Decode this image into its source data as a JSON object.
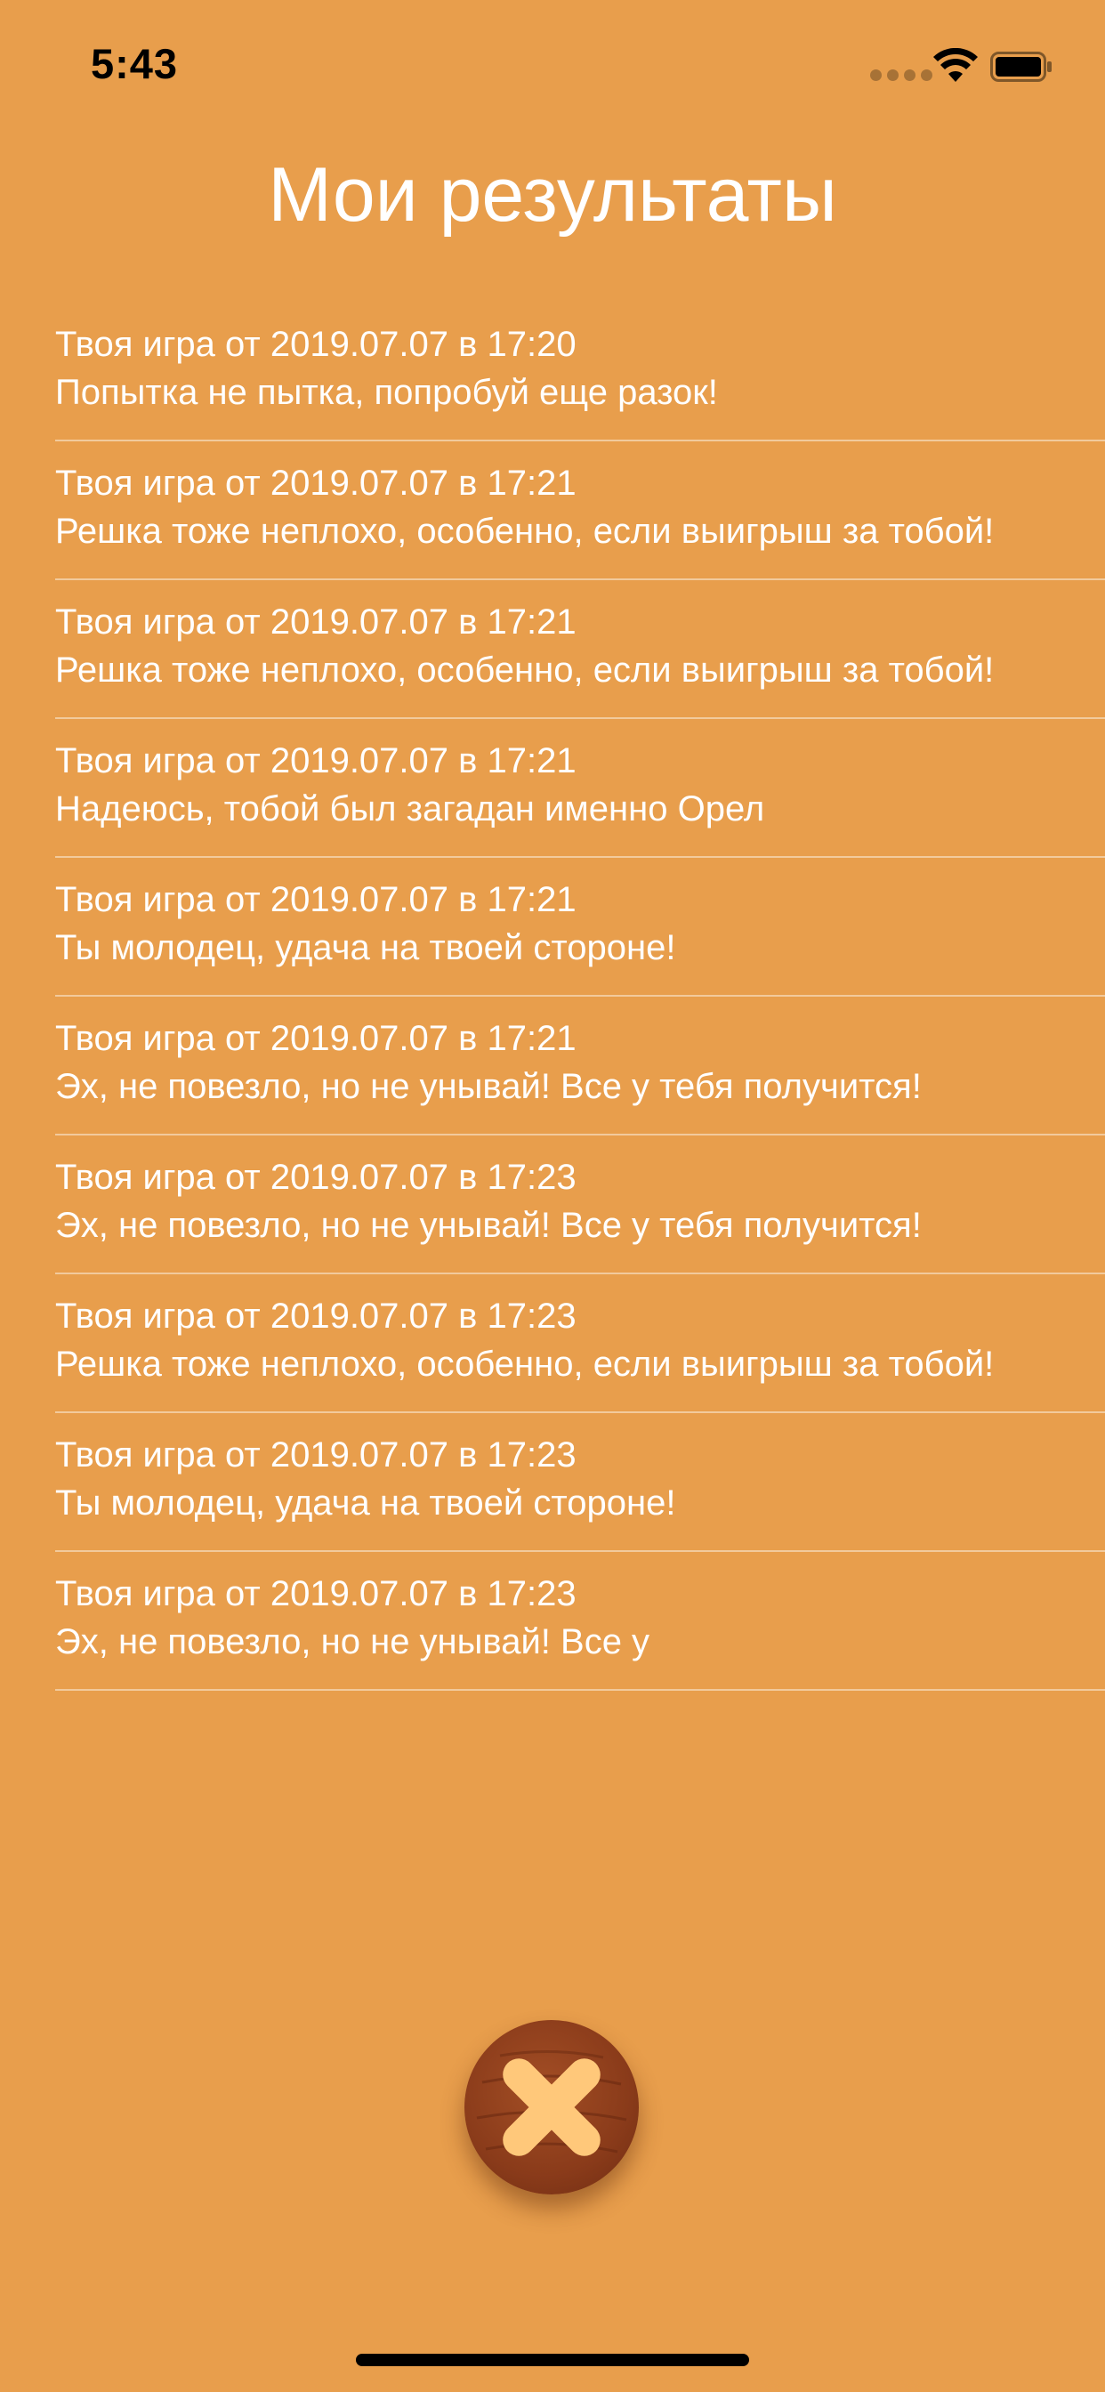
{
  "status_bar": {
    "time": "5:43",
    "signal_icon": "signal-dots-icon",
    "wifi_icon": "wifi-icon",
    "battery_icon": "battery-icon"
  },
  "header": {
    "title": "Мои результаты"
  },
  "results": [
    {
      "date": "Твоя игра от 2019.07.07 в 17:20",
      "message": "Попытка не пытка, попробуй еще разок!"
    },
    {
      "date": "Твоя игра от 2019.07.07 в 17:21",
      "message": "Решка тоже неплохо, особенно, если выигрыш за тобой!"
    },
    {
      "date": "Твоя игра от 2019.07.07 в 17:21",
      "message": "Решка тоже неплохо, особенно, если выигрыш за тобой!"
    },
    {
      "date": "Твоя игра от 2019.07.07 в 17:21",
      "message": "Надеюсь, тобой был загадан именно Орел"
    },
    {
      "date": "Твоя игра от 2019.07.07 в 17:21",
      "message": "Ты молодец, удача на твоей стороне!"
    },
    {
      "date": "Твоя игра от 2019.07.07 в 17:21",
      "message": "Эх, не повезло, но не унывай! Все у тебя получится!"
    },
    {
      "date": "Твоя игра от 2019.07.07 в 17:23",
      "message": "Эх, не повезло, но не унывай! Все у тебя получится!"
    },
    {
      "date": "Твоя игра от 2019.07.07 в 17:23",
      "message": "Решка тоже неплохо, особенно, если выигрыш за тобой!"
    },
    {
      "date": "Твоя игра от 2019.07.07 в 17:23",
      "message": "Ты молодец, удача на твоей стороне!"
    },
    {
      "date": "Твоя игра от 2019.07.07 в 17:23",
      "message": "Эх, не повезло, но не унывай! Все у"
    }
  ],
  "close_button": {
    "icon": "close-x-icon"
  },
  "colors": {
    "background": "#E89E4C",
    "button_wood": "#8A3B1A",
    "button_cross": "#FFC87A"
  }
}
